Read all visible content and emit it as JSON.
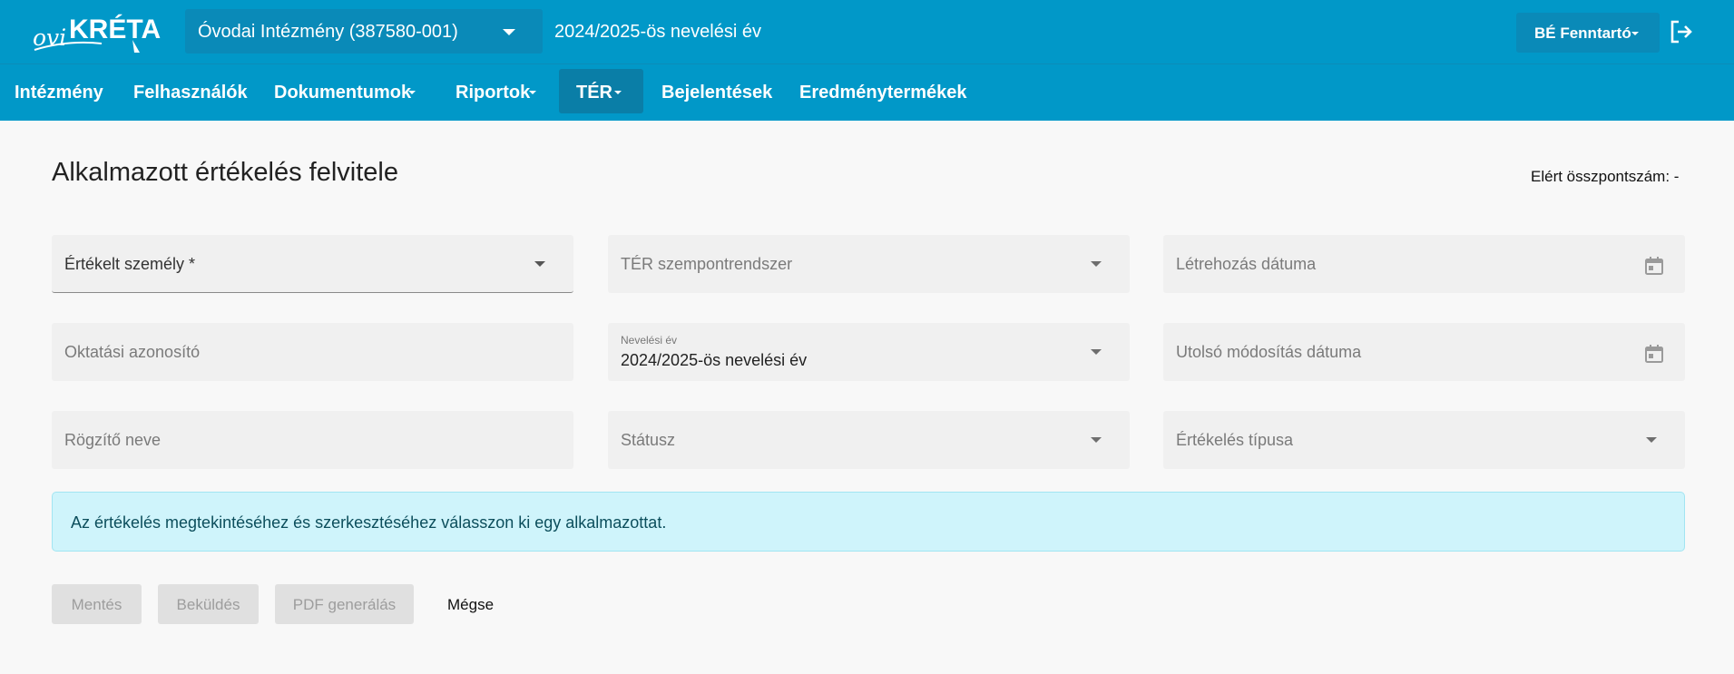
{
  "header": {
    "logo_text": "oviKRÉTA",
    "institution": "Óvodai Intézmény (387580-001)",
    "school_year": "2024/2025-ös nevelési év",
    "user": "BÉ Fenntartó"
  },
  "nav": {
    "items": [
      {
        "label": "Intézmény",
        "dropdown": false
      },
      {
        "label": "Felhasználók",
        "dropdown": false
      },
      {
        "label": "Dokumentumok",
        "dropdown": true
      },
      {
        "label": "Riportok",
        "dropdown": true
      },
      {
        "label": "TÉR",
        "dropdown": true,
        "active": true
      },
      {
        "label": "Bejelentések",
        "dropdown": false
      },
      {
        "label": "Eredménytermékek",
        "dropdown": false
      }
    ]
  },
  "page": {
    "title": "Alkalmazott értékelés felvitele",
    "score_label": "Elért összpontszám: -"
  },
  "form": {
    "evaluated_person": {
      "placeholder": "Értékelt személy *",
      "required": true
    },
    "ter_system": {
      "placeholder": "TÉR szempontrendszer"
    },
    "created_date": {
      "placeholder": "Létrehozás dátuma"
    },
    "education_id": {
      "placeholder": "Oktatási azonosító"
    },
    "school_year": {
      "label": "Nevelési év",
      "value": "2024/2025-ös nevelési év"
    },
    "modified_date": {
      "placeholder": "Utolsó módosítás dátuma"
    },
    "recorder_name": {
      "placeholder": "Rögzítő neve"
    },
    "status": {
      "placeholder": "Státusz"
    },
    "evaluation_type": {
      "placeholder": "Értékelés típusa"
    }
  },
  "alert": {
    "text": "Az értékelés megtekintéséhez és szerkesztéséhez válasszon ki egy alkalmazottat."
  },
  "actions": {
    "save": "Mentés",
    "submit": "Beküldés",
    "pdf": "PDF generálás",
    "cancel": "Mégse"
  },
  "colors": {
    "primary": "#0198c8",
    "primary_dark": "#0a8ab8",
    "active_nav": "#0a7ea7",
    "alert_bg": "#cff4fb"
  },
  "icons": [
    "chevron-down-icon",
    "logout-icon",
    "calendar-icon"
  ]
}
